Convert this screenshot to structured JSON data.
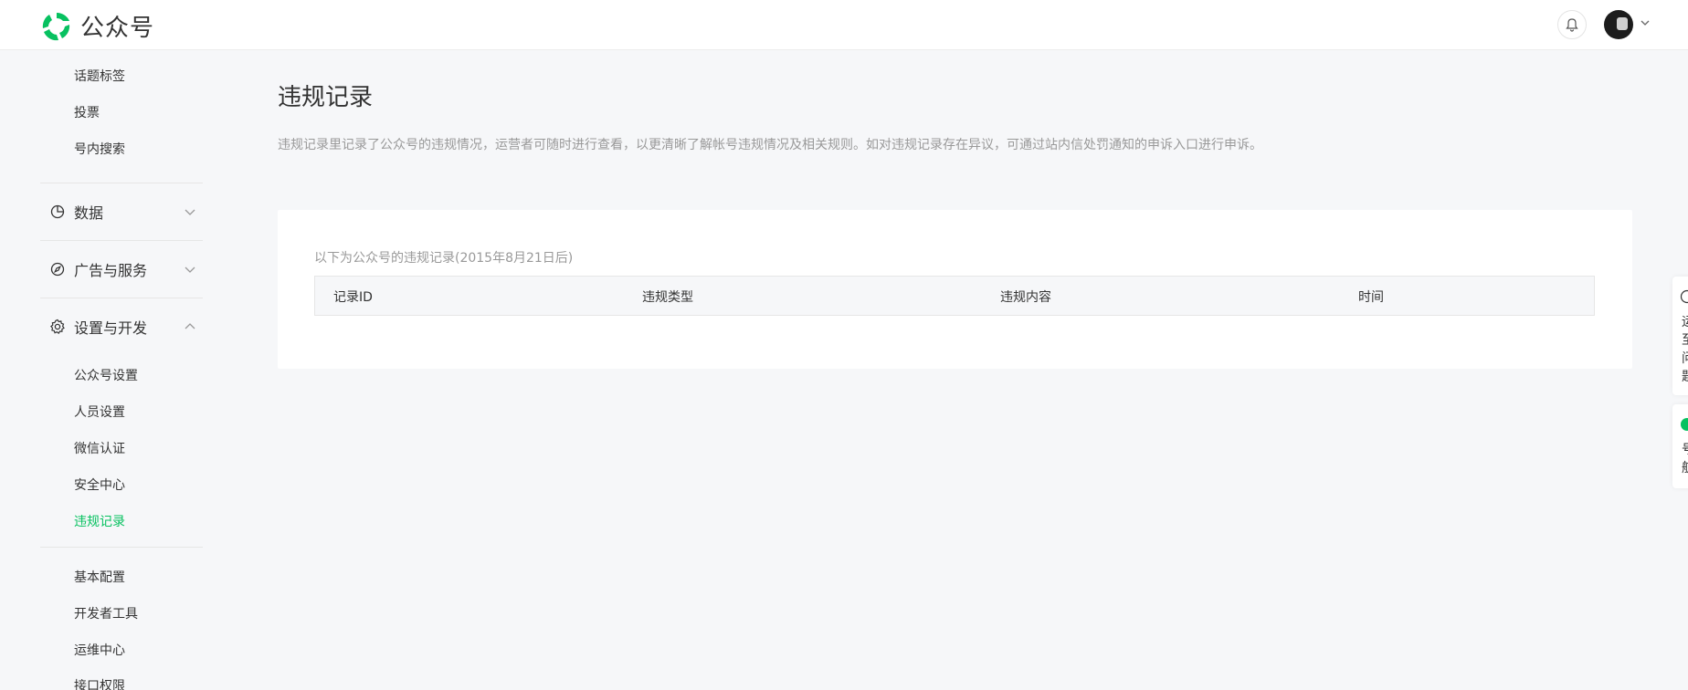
{
  "header": {
    "app_name": "公众号"
  },
  "sidebar": {
    "top_items": [
      {
        "label": "话题标签"
      },
      {
        "label": "投票"
      },
      {
        "label": "号内搜索"
      }
    ],
    "groups": [
      {
        "label": "数据",
        "expanded": false
      },
      {
        "label": "广告与服务",
        "expanded": false
      },
      {
        "label": "设置与开发",
        "expanded": true
      }
    ],
    "settings_items": [
      {
        "label": "公众号设置"
      },
      {
        "label": "人员设置"
      },
      {
        "label": "微信认证"
      },
      {
        "label": "安全中心"
      },
      {
        "label": "违规记录",
        "active": true
      }
    ],
    "dev_items": [
      {
        "label": "基本配置"
      },
      {
        "label": "开发者工具"
      },
      {
        "label": "运维中心"
      },
      {
        "label": "接口权限"
      }
    ]
  },
  "main": {
    "title": "违规记录",
    "description": "违规记录里记录了公众号的违规情况，运营者可随时进行查看，以更清晰了解帐号违规情况及相关规则。如对违规记录存在异议，可通过站内信处罚通知的申诉入口进行申诉。",
    "card_caption": "以下为公众号的违规记录(2015年8月21日后)",
    "table_headers": [
      "记录ID",
      "违规类型",
      "违规内容",
      "时间"
    ]
  },
  "floating": {
    "panel1_lines": [
      "运",
      "至",
      "问",
      "题"
    ],
    "panel2_lines": [
      "号",
      "航"
    ]
  },
  "colors": {
    "accent": "#07c160",
    "background": "#f6f7f9"
  }
}
